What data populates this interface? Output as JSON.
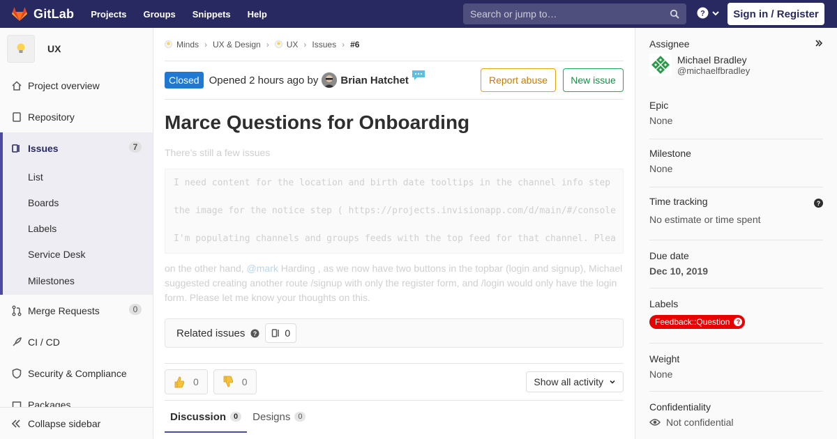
{
  "nav": {
    "brand": "GitLab",
    "items": [
      "Projects",
      "Groups",
      "Snippets",
      "Help"
    ],
    "search_placeholder": "Search or jump to…",
    "signin": "Sign in / Register"
  },
  "sidebar": {
    "project_name": "UX",
    "items": [
      {
        "label": "Project overview",
        "icon": "home-icon"
      },
      {
        "label": "Repository",
        "icon": "doc-icon"
      },
      {
        "label": "Issues",
        "icon": "issues-icon",
        "count": "7"
      },
      {
        "label": "Merge Requests",
        "icon": "merge-icon",
        "count": "0"
      },
      {
        "label": "CI / CD",
        "icon": "rocket-icon"
      },
      {
        "label": "Security & Compliance",
        "icon": "shield-icon"
      },
      {
        "label": "Packages",
        "icon": "package-icon"
      }
    ],
    "issues_sub": [
      "List",
      "Boards",
      "Labels",
      "Service Desk",
      "Milestones"
    ],
    "collapse": "Collapse sidebar"
  },
  "breadcrumbs": [
    "Minds",
    "UX & Design",
    "UX",
    "Issues",
    "#6"
  ],
  "issue": {
    "status": "Closed",
    "opened_text": "Opened 2 hours ago by",
    "author": "Brian Hatchet",
    "report_abuse": "Report abuse",
    "new_issue": "New issue",
    "title": "Marce Questions for Onboarding",
    "description_intro": "There's still a few issues",
    "code_lines": [
      "I need content for the location and birth date tooltips in the channel info step",
      "the image for the notice step ( https://projects.invisionapp.com/d/main/#/console",
      "I'm populating channels and groups feeds with the top feed for that channel. Plea"
    ],
    "desc2_before": "on the other hand, ",
    "desc2_mention": "@mark",
    "desc2_after": " Harding , as we now have two buttons in the topbar (login and signup), Michael suggested creating another route /signup with only the register form, and /login would only have the login form. Please let me know your thoughts on this.",
    "related_label": "Related issues",
    "related_count": "0",
    "thumbs_up": "0",
    "thumbs_down": "0",
    "activity_filter": "Show all activity",
    "tabs": [
      {
        "label": "Discussion",
        "count": "0"
      },
      {
        "label": "Designs",
        "count": "0"
      }
    ]
  },
  "right_sidebar": {
    "assignee_label": "Assignee",
    "assignee_name": "Michael Bradley",
    "assignee_handle": "@michaelfbradley",
    "epic_label": "Epic",
    "epic_value": "None",
    "milestone_label": "Milestone",
    "milestone_value": "None",
    "time_label": "Time tracking",
    "time_value": "No estimate or time spent",
    "due_label": "Due date",
    "due_value": "Dec 10, 2019",
    "labels_label": "Labels",
    "label_pill": "Feedback::Question",
    "weight_label": "Weight",
    "weight_value": "None",
    "confidentiality_label": "Confidentiality",
    "confidentiality_value": "Not confidential"
  },
  "colors": {
    "navbar": "#292961",
    "closed_badge": "#1f78d1",
    "label_pill": "#e60000",
    "report_abuse": "#e1a300",
    "new_issue": "#1aaa55"
  }
}
